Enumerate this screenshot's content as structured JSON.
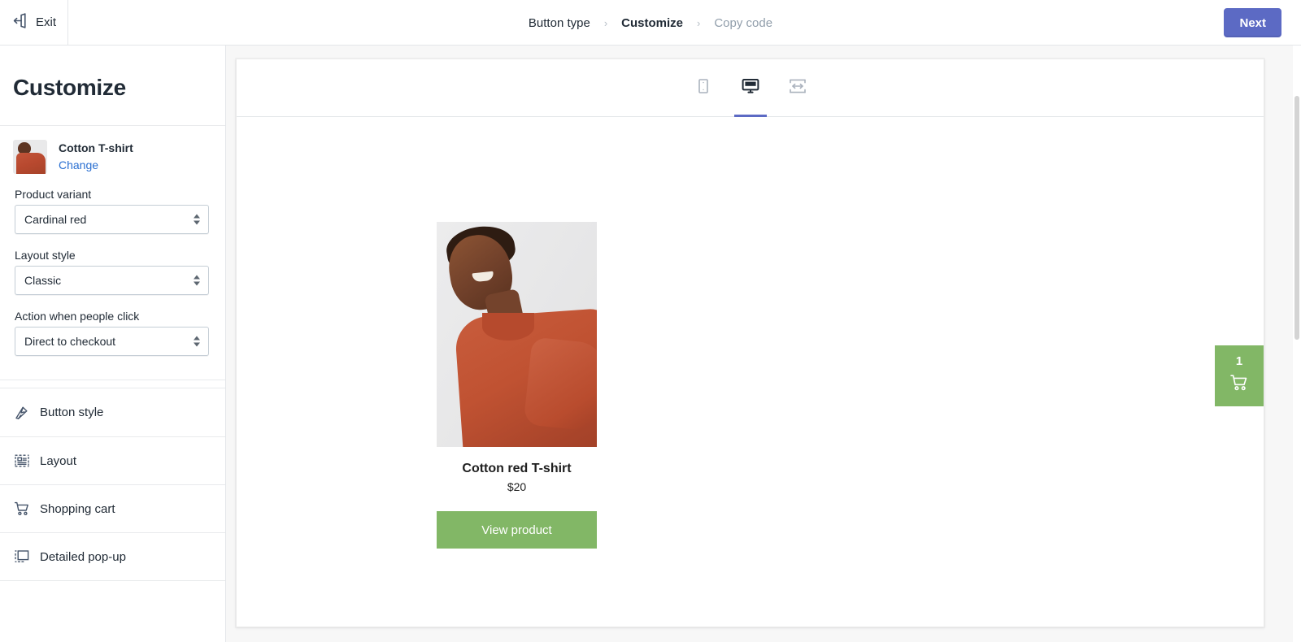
{
  "topbar": {
    "exit_label": "Exit",
    "exit_icon": "exit-arrow-icon",
    "next_label": "Next",
    "breadcrumb": [
      {
        "label": "Button type",
        "state": "done"
      },
      {
        "label": "Customize",
        "state": "current"
      },
      {
        "label": "Copy code",
        "state": "upcoming"
      }
    ],
    "separator": "›",
    "accent_color": "#5c6ac4"
  },
  "sidebar": {
    "title": "Customize",
    "product": {
      "name": "Cotton T-shirt",
      "change_label": "Change",
      "thumbnail_alt": "cotton-tshirt-thumbnail",
      "link_color": "#2a6fd1"
    },
    "fields": [
      {
        "label": "Product variant",
        "value": "Cardinal red",
        "name": "product-variant-select"
      },
      {
        "label": "Layout style",
        "value": "Classic",
        "name": "layout-style-select"
      },
      {
        "label": "Action when people click",
        "value": "Direct to checkout",
        "name": "action-on-click-select"
      }
    ],
    "menu": [
      {
        "label": "Button style",
        "icon": "brush-icon",
        "name": "sidebar-item-button-style"
      },
      {
        "label": "Layout",
        "icon": "layout-list-icon",
        "name": "sidebar-item-layout"
      },
      {
        "label": "Shopping cart",
        "icon": "shopping-cart-icon",
        "name": "sidebar-item-shopping-cart"
      },
      {
        "label": "Detailed pop-up",
        "icon": "popup-frame-icon",
        "name": "sidebar-item-detailed-popup"
      }
    ]
  },
  "preview": {
    "devices": [
      {
        "icon": "mobile-icon",
        "name": "device-tab-mobile",
        "active": false
      },
      {
        "icon": "desktop-icon",
        "name": "device-tab-desktop",
        "active": true
      },
      {
        "icon": "responsive-width-icon",
        "name": "device-tab-responsive",
        "active": false
      }
    ],
    "product": {
      "title": "Cotton red T-shirt",
      "price": "$20",
      "button_label": "View product",
      "image_alt": "woman-wearing-red-tshirt",
      "button_color": "#82b766"
    },
    "cart": {
      "count": "1",
      "icon": "shopping-cart-icon",
      "color": "#82b766"
    }
  }
}
